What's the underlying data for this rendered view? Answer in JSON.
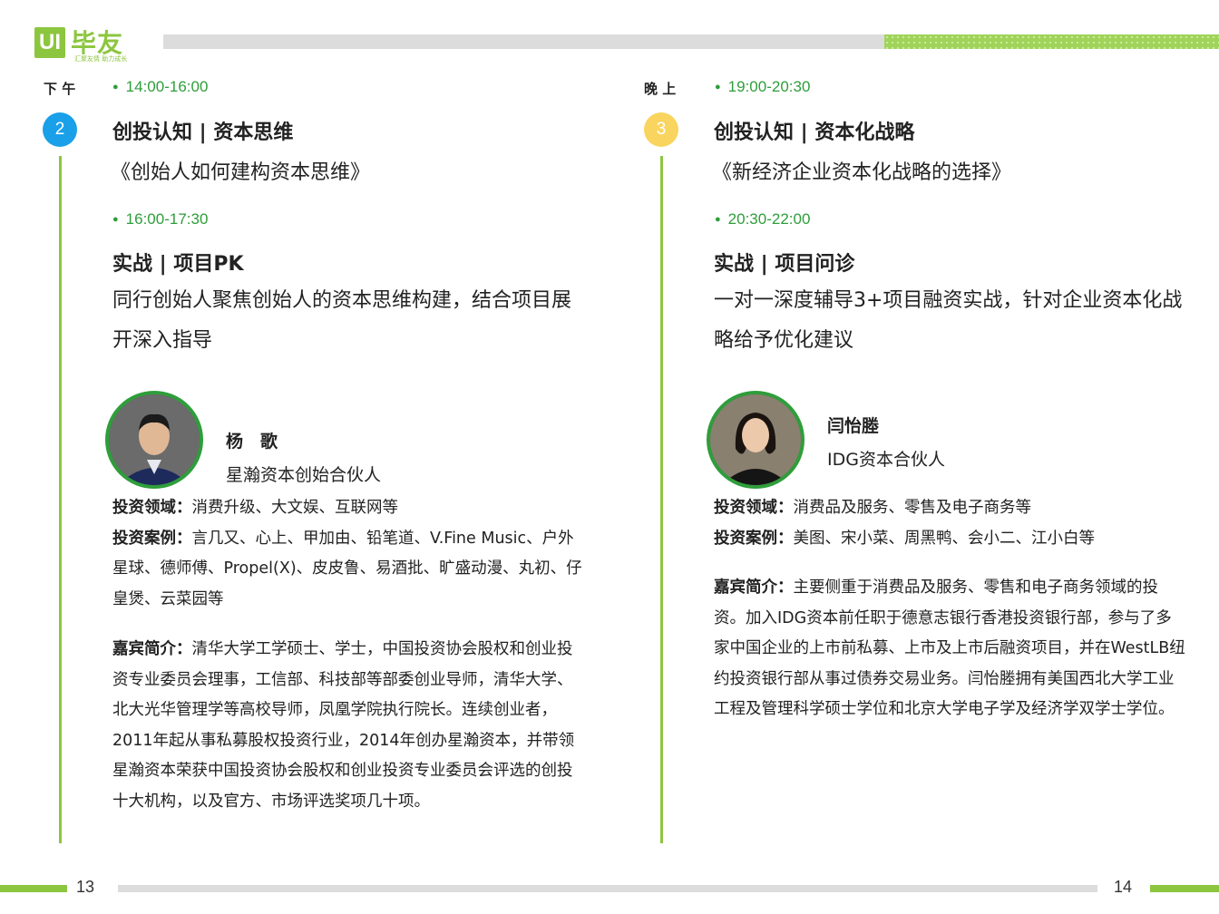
{
  "header": {
    "logo_mark": "UI",
    "logo_name": "毕友",
    "logo_slogan": "汇聚友情 助力成长"
  },
  "pages": {
    "left": "13",
    "right": "14"
  },
  "left": {
    "period": "下 午",
    "badge": "2",
    "s1": {
      "time": "14:00-16:00",
      "title": "创投认知 | 资本思维",
      "subtitle": "《创始人如何建构资本思维》"
    },
    "s2": {
      "time": "16:00-17:30",
      "title": "实战 | 项目PK",
      "desc": "同行创始人聚焦创始人的资本思维构建，结合项目展开深入指导"
    },
    "speaker": {
      "name": "杨　歌",
      "role": "星瀚资本创始合伙人",
      "field_label": "投资领域：",
      "field": "消费升级、大文娱、互联网等",
      "cases_label": "投资案例：",
      "cases": "言几又、心上、甲加由、铅笔道、V.Fine Music、户外星球、德师傅、Propel(X)、皮皮鲁、易酒批、旷盛动漫、丸初、仔皇煲、云菜园等",
      "bio_label": "嘉宾简介：",
      "bio": "清华大学工学硕士、学士，中国投资协会股权和创业投资专业委员会理事，工信部、科技部等部委创业导师，清华大学、北大光华管理学等高校导师，凤凰学院执行院长。连续创业者，2011年起从事私募股权投资行业，2014年创办星瀚资本，并带领星瀚资本荣获中国投资协会股权和创业投资专业委员会评选的创投十大机构，以及官方、市场评选奖项几十项。"
    }
  },
  "right": {
    "period": "晚 上",
    "badge": "3",
    "s1": {
      "time": "19:00-20:30",
      "title": "创投认知 | 资本化战略",
      "subtitle": "《新经济企业资本化战略的选择》"
    },
    "s2": {
      "time": "20:30-22:00",
      "title": "实战 | 项目问诊",
      "desc": "一对一深度辅导3+项目融资实战，针对企业资本化战略给予优化建议"
    },
    "speaker": {
      "name": "闫怡塍",
      "role": "IDG资本合伙人",
      "field_label": "投资领域：",
      "field": "消费品及服务、零售及电子商务等",
      "cases_label": "投资案例：",
      "cases": "美图、宋小菜、周黑鸭、会小二、江小白等",
      "bio_label": "嘉宾简介：",
      "bio": "主要侧重于消费品及服务、零售和电子商务领域的投资。加入IDG资本前任职于德意志银行香港投资银行部，参与了多家中国企业的上市前私募、上市及上市后融资项目，并在WestLB纽约投资银行部从事过债券交易业务。闫怡塍拥有美国西北大学工业工程及管理科学硕士学位和北京大学电子学及经济学双学士学位。"
    }
  }
}
